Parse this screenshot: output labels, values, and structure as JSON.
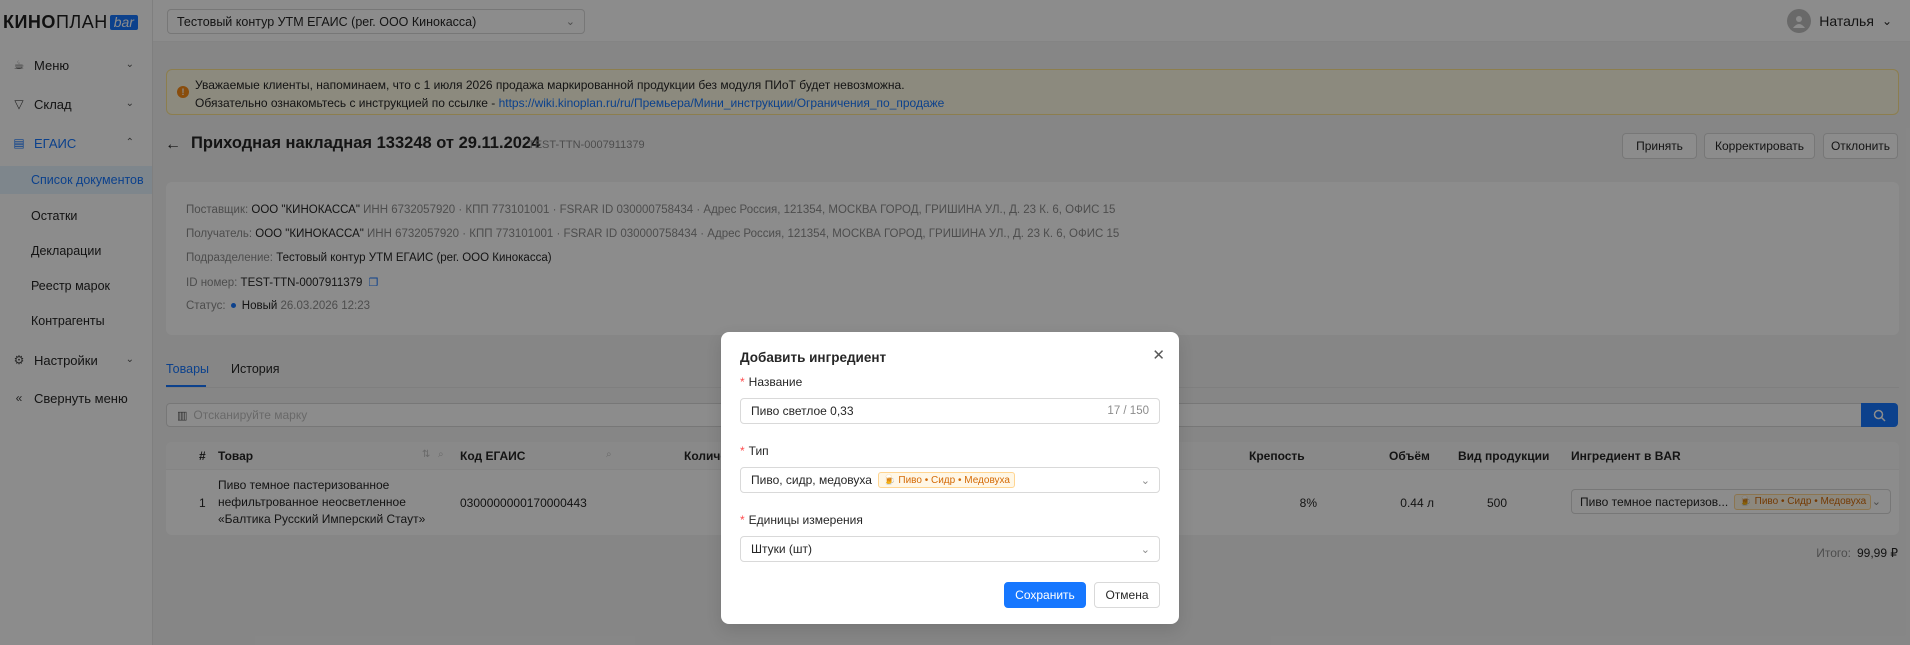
{
  "logo": {
    "part1": "КИНО",
    "part2": "ПЛАН",
    "bar": "bar"
  },
  "sidebar": {
    "items": [
      {
        "label": "Меню",
        "icon": "menu-icon"
      },
      {
        "label": "Склад",
        "icon": "filter-icon"
      },
      {
        "label": "ЕГАИС",
        "icon": "document-icon"
      },
      {
        "label": "Настройки",
        "icon": "gear-icon"
      },
      {
        "label": "Свернуть меню",
        "icon": "collapse-icon"
      }
    ],
    "sub_items": [
      "Список документов",
      "Остатки",
      "Декларации",
      "Реестр марок",
      "Контрагенты"
    ]
  },
  "topbar": {
    "context_select": "Тестовый контур УТМ ЕГАИС (рег. ООО Кинокасса)",
    "user_name": "Наталья"
  },
  "notice": {
    "line1": "Уважаемые клиенты, напоминаем, что с 1 июля 2026 продажа маркированной продукции без модуля ПИоТ будет невозможна.",
    "line2_prefix": "Обязательно ознакомьтесь с инструкцией по ссылке - ",
    "link": "https://wiki.kinoplan.ru/ru/Премьера/Мини_инструкции/Ограничения_по_продаже"
  },
  "document": {
    "title": "Приходная накладная 133248 от 29.11.2024",
    "subtitle": "TEST-TTN-0007911379",
    "actions": {
      "accept": "Принять",
      "correct": "Корректировать",
      "reject": "Отклонить"
    }
  },
  "info": {
    "supplier_label": "Поставщик:",
    "supplier_name": "ООО \"КИНОКАССА\"",
    "supplier_details": " ИНН 6732057920 · КПП 773101001 · FSRAR ID 030000758434 · Адрес Россия, 121354, МОСКВА ГОРОД, ГРИШИНА УЛ., Д. 23 К. 6, ОФИС 15",
    "receiver_label": "Получатель:",
    "receiver_name": "ООО \"КИНОКАССА\"",
    "receiver_details": " ИНН 6732057920 · КПП 773101001 · FSRAR ID 030000758434 · Адрес Россия, 121354, МОСКВА ГОРОД, ГРИШИНА УЛ., Д. 23 К. 6, ОФИС 15",
    "division_label": "Подразделение:",
    "division_value": "Тестовый контур УТМ ЕГАИС (рег. ООО Кинокасса)",
    "id_label": "ID номер:",
    "id_value": "TEST-TTN-0007911379",
    "status_label": "Статус:",
    "status_value": "Новый",
    "status_date": "26.03.2026 12:23"
  },
  "tabs": [
    {
      "label": "Товары"
    },
    {
      "label": "История"
    }
  ],
  "scan": {
    "placeholder": "Отсканируйте марку"
  },
  "table": {
    "headers": {
      "num": "#",
      "product": "Товар",
      "egais": "Код ЕГАИС",
      "qty": "Количе",
      "strength": "Крепость",
      "volume": "Объём",
      "kind": "Вид продукции",
      "ingredient": "Ингредиент в BAR"
    },
    "rows": [
      {
        "num": "1",
        "product": "Пиво темное пастеризованное нефильтрованное неосветленное «Балтика Русский Имперский Стаут»",
        "egais": "0300000000170000443",
        "strength": "8%",
        "volume": "0.44 л",
        "kind": "500",
        "ingredient": "Пиво темное пастеризов...",
        "ingredient_tag": "Пиво • Сидр • Медовуха"
      }
    ]
  },
  "total": {
    "label": "Итого:",
    "value": "99,99 ₽"
  },
  "modal": {
    "title": "Добавить ингредиент",
    "name_label": "Название",
    "name_value": "Пиво светлое 0,33",
    "name_count": "17 / 150",
    "type_label": "Тип",
    "type_value": "Пиво, сидр, медовуха",
    "type_tag": "Пиво • Сидр • Медовуха",
    "unit_label": "Единицы измерения",
    "unit_value": "Штуки (шт)",
    "save": "Сохранить",
    "cancel": "Отмена"
  },
  "colors": {
    "accent": "#1677ff",
    "notice_bg": "#fffbe6",
    "tag_bg": "#fff7e6",
    "tag_text": "#d46b08",
    "required": "#ff4d4f"
  }
}
